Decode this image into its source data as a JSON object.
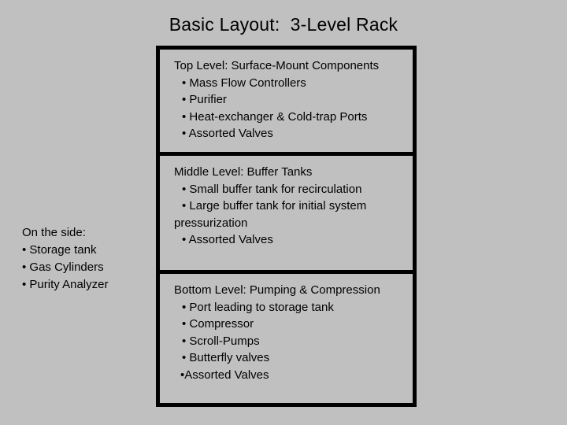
{
  "slide": {
    "title": "Basic Layout:  3-Level Rack",
    "background_color": "#c0c0c0",
    "border_color": "#000000",
    "text_color": "#000000"
  },
  "side_block": {
    "heading": "On the side:",
    "items": [
      "• Storage tank",
      "• Gas Cylinders",
      "• Purity Analyzer"
    ]
  },
  "rack": {
    "levels": [
      {
        "name": "top-level",
        "heading": "Top Level: Surface-Mount Components",
        "items": [
          "• Mass Flow Controllers",
          "• Purifier",
          "• Heat-exchanger & Cold-trap Ports",
          "• Assorted Valves"
        ]
      },
      {
        "name": "middle-level",
        "heading": "Middle Level: Buffer Tanks",
        "items": [
          "• Small buffer tank for recirculation",
          "• Large buffer tank for initial system",
          "pressurization",
          "• Assorted Valves"
        ]
      },
      {
        "name": "bottom-level",
        "heading": "Bottom Level: Pumping & Compression",
        "items": [
          "• Port leading to storage tank",
          "• Compressor",
          "• Scroll-Pumps",
          "• Butterfly valves",
          "•Assorted Valves"
        ]
      }
    ]
  }
}
